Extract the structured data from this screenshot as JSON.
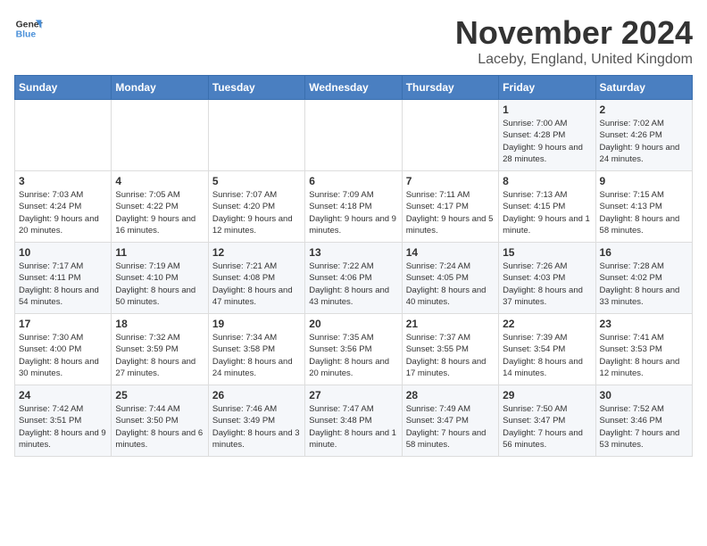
{
  "logo": {
    "line1": "General",
    "line2": "Blue"
  },
  "title": "November 2024",
  "location": "Laceby, England, United Kingdom",
  "weekdays": [
    "Sunday",
    "Monday",
    "Tuesday",
    "Wednesday",
    "Thursday",
    "Friday",
    "Saturday"
  ],
  "weeks": [
    [
      {
        "day": "",
        "info": ""
      },
      {
        "day": "",
        "info": ""
      },
      {
        "day": "",
        "info": ""
      },
      {
        "day": "",
        "info": ""
      },
      {
        "day": "",
        "info": ""
      },
      {
        "day": "1",
        "info": "Sunrise: 7:00 AM\nSunset: 4:28 PM\nDaylight: 9 hours and 28 minutes."
      },
      {
        "day": "2",
        "info": "Sunrise: 7:02 AM\nSunset: 4:26 PM\nDaylight: 9 hours and 24 minutes."
      }
    ],
    [
      {
        "day": "3",
        "info": "Sunrise: 7:03 AM\nSunset: 4:24 PM\nDaylight: 9 hours and 20 minutes."
      },
      {
        "day": "4",
        "info": "Sunrise: 7:05 AM\nSunset: 4:22 PM\nDaylight: 9 hours and 16 minutes."
      },
      {
        "day": "5",
        "info": "Sunrise: 7:07 AM\nSunset: 4:20 PM\nDaylight: 9 hours and 12 minutes."
      },
      {
        "day": "6",
        "info": "Sunrise: 7:09 AM\nSunset: 4:18 PM\nDaylight: 9 hours and 9 minutes."
      },
      {
        "day": "7",
        "info": "Sunrise: 7:11 AM\nSunset: 4:17 PM\nDaylight: 9 hours and 5 minutes."
      },
      {
        "day": "8",
        "info": "Sunrise: 7:13 AM\nSunset: 4:15 PM\nDaylight: 9 hours and 1 minute."
      },
      {
        "day": "9",
        "info": "Sunrise: 7:15 AM\nSunset: 4:13 PM\nDaylight: 8 hours and 58 minutes."
      }
    ],
    [
      {
        "day": "10",
        "info": "Sunrise: 7:17 AM\nSunset: 4:11 PM\nDaylight: 8 hours and 54 minutes."
      },
      {
        "day": "11",
        "info": "Sunrise: 7:19 AM\nSunset: 4:10 PM\nDaylight: 8 hours and 50 minutes."
      },
      {
        "day": "12",
        "info": "Sunrise: 7:21 AM\nSunset: 4:08 PM\nDaylight: 8 hours and 47 minutes."
      },
      {
        "day": "13",
        "info": "Sunrise: 7:22 AM\nSunset: 4:06 PM\nDaylight: 8 hours and 43 minutes."
      },
      {
        "day": "14",
        "info": "Sunrise: 7:24 AM\nSunset: 4:05 PM\nDaylight: 8 hours and 40 minutes."
      },
      {
        "day": "15",
        "info": "Sunrise: 7:26 AM\nSunset: 4:03 PM\nDaylight: 8 hours and 37 minutes."
      },
      {
        "day": "16",
        "info": "Sunrise: 7:28 AM\nSunset: 4:02 PM\nDaylight: 8 hours and 33 minutes."
      }
    ],
    [
      {
        "day": "17",
        "info": "Sunrise: 7:30 AM\nSunset: 4:00 PM\nDaylight: 8 hours and 30 minutes."
      },
      {
        "day": "18",
        "info": "Sunrise: 7:32 AM\nSunset: 3:59 PM\nDaylight: 8 hours and 27 minutes."
      },
      {
        "day": "19",
        "info": "Sunrise: 7:34 AM\nSunset: 3:58 PM\nDaylight: 8 hours and 24 minutes."
      },
      {
        "day": "20",
        "info": "Sunrise: 7:35 AM\nSunset: 3:56 PM\nDaylight: 8 hours and 20 minutes."
      },
      {
        "day": "21",
        "info": "Sunrise: 7:37 AM\nSunset: 3:55 PM\nDaylight: 8 hours and 17 minutes."
      },
      {
        "day": "22",
        "info": "Sunrise: 7:39 AM\nSunset: 3:54 PM\nDaylight: 8 hours and 14 minutes."
      },
      {
        "day": "23",
        "info": "Sunrise: 7:41 AM\nSunset: 3:53 PM\nDaylight: 8 hours and 12 minutes."
      }
    ],
    [
      {
        "day": "24",
        "info": "Sunrise: 7:42 AM\nSunset: 3:51 PM\nDaylight: 8 hours and 9 minutes."
      },
      {
        "day": "25",
        "info": "Sunrise: 7:44 AM\nSunset: 3:50 PM\nDaylight: 8 hours and 6 minutes."
      },
      {
        "day": "26",
        "info": "Sunrise: 7:46 AM\nSunset: 3:49 PM\nDaylight: 8 hours and 3 minutes."
      },
      {
        "day": "27",
        "info": "Sunrise: 7:47 AM\nSunset: 3:48 PM\nDaylight: 8 hours and 1 minute."
      },
      {
        "day": "28",
        "info": "Sunrise: 7:49 AM\nSunset: 3:47 PM\nDaylight: 7 hours and 58 minutes."
      },
      {
        "day": "29",
        "info": "Sunrise: 7:50 AM\nSunset: 3:47 PM\nDaylight: 7 hours and 56 minutes."
      },
      {
        "day": "30",
        "info": "Sunrise: 7:52 AM\nSunset: 3:46 PM\nDaylight: 7 hours and 53 minutes."
      }
    ]
  ]
}
